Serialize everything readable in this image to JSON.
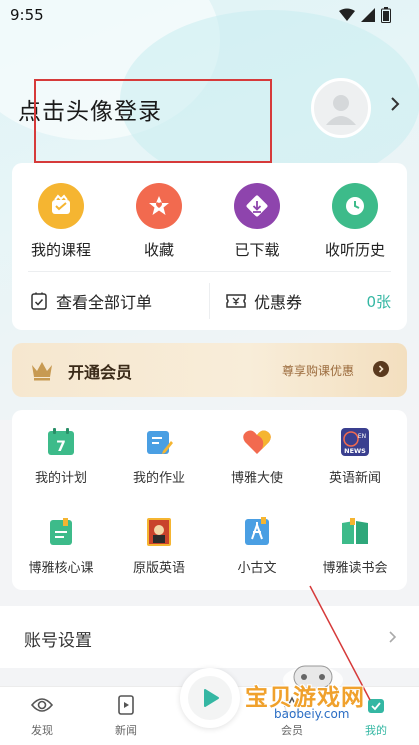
{
  "status": {
    "time": "9:55"
  },
  "profile": {
    "login_text": "点击头像登录"
  },
  "quick_actions": [
    {
      "label": "我的课程",
      "icon": "course-icon",
      "color": "#f5b531"
    },
    {
      "label": "收藏",
      "icon": "favorite-icon",
      "color": "#f26a4f"
    },
    {
      "label": "已下载",
      "icon": "download-icon",
      "color": "#8e44ad"
    },
    {
      "label": "收听历史",
      "icon": "history-icon",
      "color": "#3dbb8a"
    }
  ],
  "orders": {
    "label": "查看全部订单"
  },
  "coupons": {
    "label": "优惠券",
    "count": "0张"
  },
  "vip": {
    "title": "开通会员",
    "subtitle": "尊享购课优惠"
  },
  "features": [
    {
      "label": "我的计划",
      "icon": "calendar-icon"
    },
    {
      "label": "我的作业",
      "icon": "homework-icon"
    },
    {
      "label": "博雅大使",
      "icon": "heart-icon"
    },
    {
      "label": "英语新闻",
      "icon": "news-icon"
    },
    {
      "label": "博雅核心课",
      "icon": "core-course-icon"
    },
    {
      "label": "原版英语",
      "icon": "book-cover-icon"
    },
    {
      "label": "小古文",
      "icon": "classical-icon"
    },
    {
      "label": "博雅读书会",
      "icon": "reading-club-icon"
    }
  ],
  "settings": {
    "label": "账号设置"
  },
  "tabs": [
    {
      "label": "发现",
      "icon": "discover-icon"
    },
    {
      "label": "新闻",
      "icon": "news-tab-icon"
    },
    {
      "label": "会员",
      "icon": "member-icon"
    },
    {
      "label": "我的",
      "icon": "mine-icon"
    }
  ],
  "watermark": {
    "text": "宝贝游戏网",
    "url": "baobeiy.com"
  },
  "colors": {
    "accent": "#34b7a3",
    "highlight_box": "#d63a3a"
  }
}
